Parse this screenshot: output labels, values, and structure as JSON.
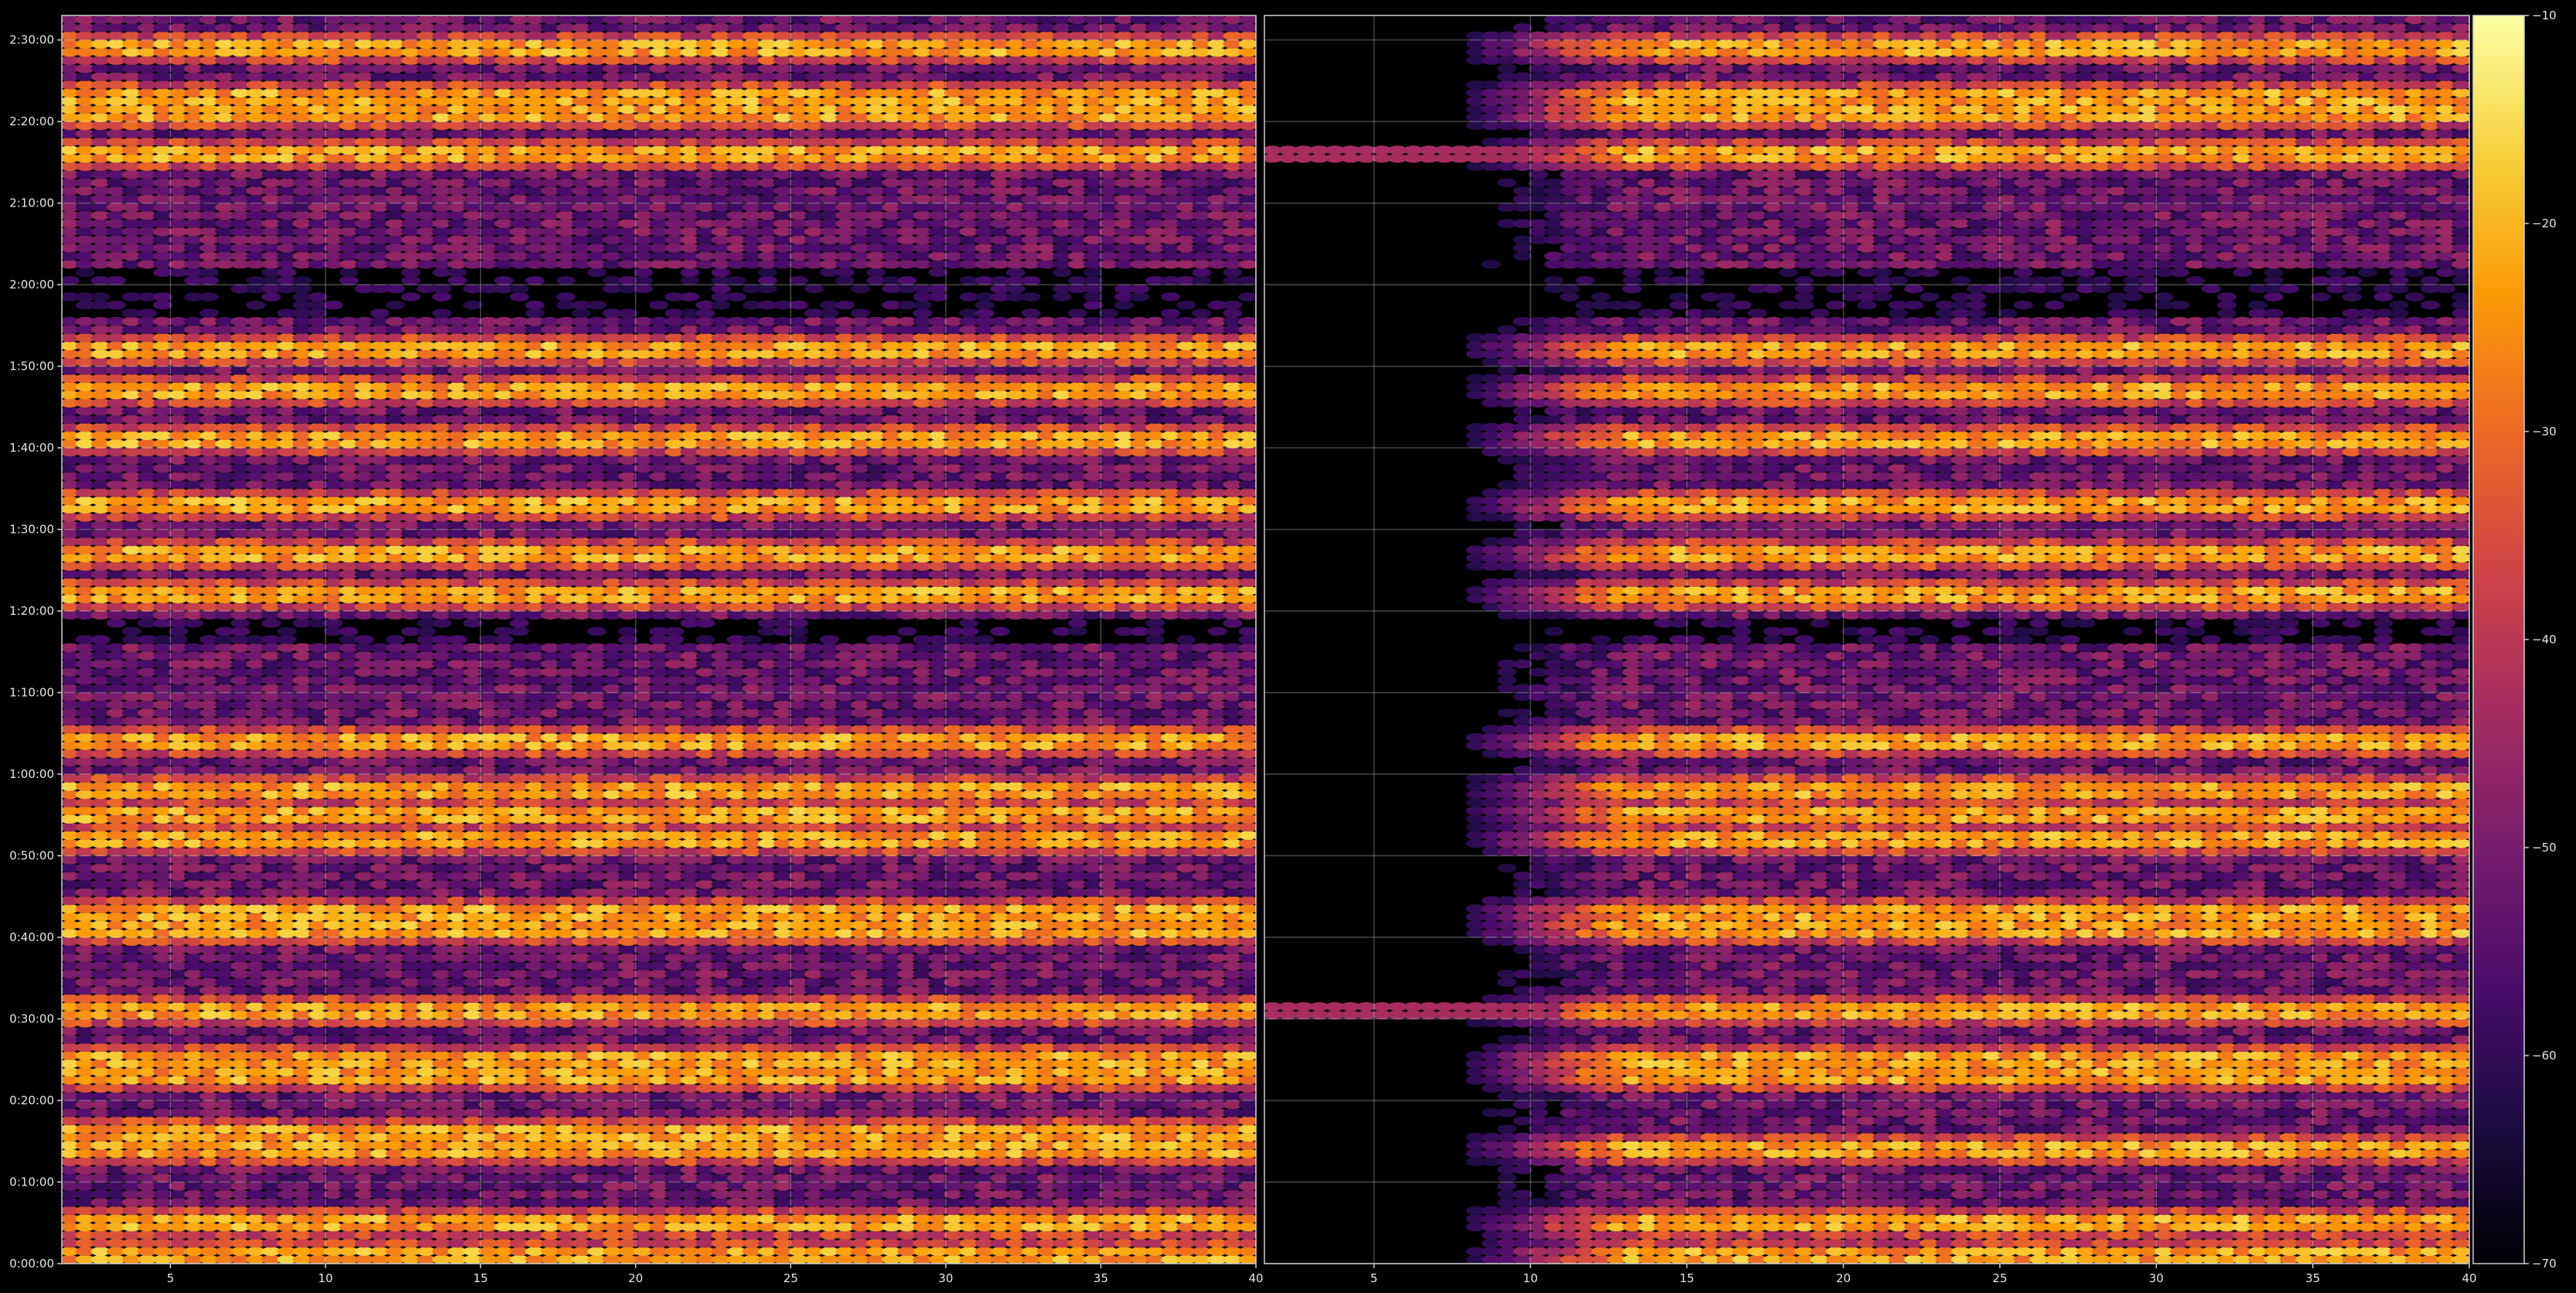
{
  "chart_data": {
    "type": "heatmap",
    "title": "",
    "xlabel": "",
    "ylabel": "",
    "grid": true,
    "background": "#000000",
    "colormap": "inferno",
    "panels": [
      {
        "name": "",
        "xlim": [
          1.5,
          40
        ],
        "x_ticks": [
          5,
          10,
          15,
          20,
          25,
          30,
          35,
          40
        ],
        "x_tick_labels": [
          "5",
          "10",
          "15",
          "20",
          "25",
          "30",
          "35",
          "40"
        ],
        "strong_bands_minutes": [
          1,
          5,
          14,
          16,
          23,
          25,
          31,
          41,
          43,
          52,
          55,
          58,
          64,
          82,
          87,
          93,
          101,
          107,
          112,
          136,
          141,
          143,
          149
        ],
        "fades_in_from_x": 1.5
      },
      {
        "name": "",
        "xlim": [
          1.5,
          40
        ],
        "x_ticks": [
          5,
          10,
          15,
          20,
          25,
          30,
          35,
          40
        ],
        "x_tick_labels": [
          "5",
          "10",
          "15",
          "20",
          "25",
          "30",
          "35",
          "40"
        ],
        "strong_bands_minutes": [
          1,
          5,
          14,
          23,
          25,
          31,
          41,
          43,
          52,
          55,
          58,
          64,
          82,
          87,
          93,
          101,
          107,
          112,
          136,
          141,
          143,
          149
        ],
        "fades_in_from_x": 10
      }
    ],
    "y_range_minutes": [
      0,
      153
    ],
    "y_ticks_minutes": [
      0,
      10,
      20,
      30,
      40,
      50,
      60,
      70,
      80,
      90,
      100,
      110,
      120,
      130,
      140,
      150
    ],
    "y_tick_labels": [
      "0:00:00",
      "0:10:00",
      "0:20:00",
      "0:30:00",
      "0:40:00",
      "0:50:00",
      "1:00:00",
      "1:10:00",
      "1:20:00",
      "1:30:00",
      "1:40:00",
      "1:50:00",
      "2:00:00",
      "2:10:00",
      "2:20:00",
      "2:30:00"
    ],
    "colorbar": {
      "range": [
        -70,
        -10
      ],
      "ticks": [
        -70,
        -60,
        -50,
        -40,
        -30,
        -20,
        -10
      ],
      "tick_labels": [
        "−70",
        "−60",
        "−50",
        "−40",
        "−30",
        "−20",
        "−10"
      ],
      "stops": [
        "#000004",
        "#1b0c41",
        "#4a0c6b",
        "#781c6d",
        "#a52c60",
        "#cf4446",
        "#ed6925",
        "#fb9b06",
        "#f7d13d",
        "#fcffa4"
      ]
    }
  }
}
